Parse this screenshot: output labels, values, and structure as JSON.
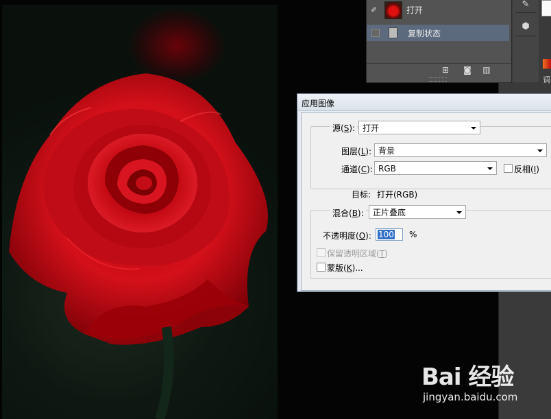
{
  "history_panel": {
    "rows": [
      {
        "label": "打开"
      },
      {
        "label": "复制状态"
      }
    ],
    "footer_icons": [
      "new-document-icon",
      "camera-icon",
      "trash-icon"
    ]
  },
  "dialog": {
    "title": "应用图像",
    "source": {
      "label_prefix": "源(",
      "hotkey": "S",
      "label_suffix": "):",
      "value": "打开"
    },
    "layer": {
      "label_prefix": "图层(",
      "hotkey": "L",
      "label_suffix": "):",
      "value": "背景"
    },
    "channel": {
      "label_prefix": "通道(",
      "hotkey": "C",
      "label_suffix": "):",
      "value": "RGB"
    },
    "invert": {
      "label_prefix": "反相(",
      "hotkey": "I",
      "label_suffix": ")",
      "checked": false
    },
    "target": {
      "label": "目标:",
      "value": "打开(RGB)"
    },
    "blending": {
      "label_prefix": "混合(",
      "hotkey": "B",
      "label_suffix": "):",
      "value": "正片叠底"
    },
    "opacity": {
      "label_prefix": "不透明度(",
      "hotkey": "O",
      "label_suffix": "):",
      "value": "100",
      "unit": "%"
    },
    "preserve_transparency": {
      "label_prefix": "保留透明区域(",
      "hotkey": "T",
      "label_suffix": ")",
      "enabled": false,
      "checked": false
    },
    "mask": {
      "label_prefix": "蒙版(",
      "hotkey": "K",
      "label_suffix": ")...",
      "checked": false
    }
  },
  "watermark": {
    "logo": "Bai 经验",
    "url": "jingyan.baidu.com"
  },
  "colors": {
    "dialog_bg": "#f0f0f0",
    "selection": "#3271c8",
    "history_highlight": "#5c6a7e",
    "panel_bg": "#535353"
  }
}
